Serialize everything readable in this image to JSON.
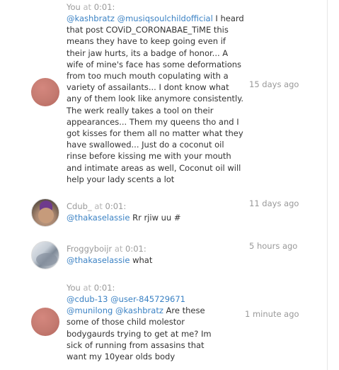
{
  "comments": [
    {
      "author": "You",
      "at_label": "at",
      "time_code": "0:01",
      "mentions": [
        "@kashbratz",
        "@musiqsoulchildofficial"
      ],
      "text": " I heard that post COViD_CORONABAE_TiME this means they have to keep going even if their jaw hurts, its a badge of honor... A wife of mine's face has some deformations from too much mouth copulating with a variety of assailants... I dont know what any of them look like anymore consistently. The werk really takes a tool on their appearances... Them my queens tho and I got kisses for them all no matter what they have swallowed... Just do a coconut oil rinse before kissing me with your mouth and intimate areas as well, Coconut oil will help your lady scents a lot",
      "posted": "15 days ago",
      "avatar_icon": "user-avatar-icon"
    },
    {
      "author": "Cdub_",
      "at_label": "at",
      "time_code": "0:01",
      "mentions": [
        "@thakaselassie"
      ],
      "text": " Rr rjiw uu #",
      "posted": "11 days ago",
      "avatar_icon": "user-avatar-icon"
    },
    {
      "author": "Froggyboijr",
      "at_label": "at",
      "time_code": "0:01",
      "mentions": [
        "@thakaselassie"
      ],
      "text": " what",
      "posted": "5 hours ago",
      "avatar_icon": "user-avatar-icon"
    },
    {
      "author": "You",
      "at_label": "at",
      "time_code": "0:01",
      "mentions": [
        "@cdub-13",
        "@user-845729671",
        "@munilong",
        "@kashbratz"
      ],
      "text": " Are these some of those child molestor bodygaurds trying to get at me? Im sick of running from assasins that want my 10year olds body",
      "posted": "1 minute ago",
      "avatar_icon": "user-avatar-icon"
    }
  ],
  "colors": {
    "mention": "#3b82c4",
    "meta": "#999999",
    "text": "#333333"
  }
}
